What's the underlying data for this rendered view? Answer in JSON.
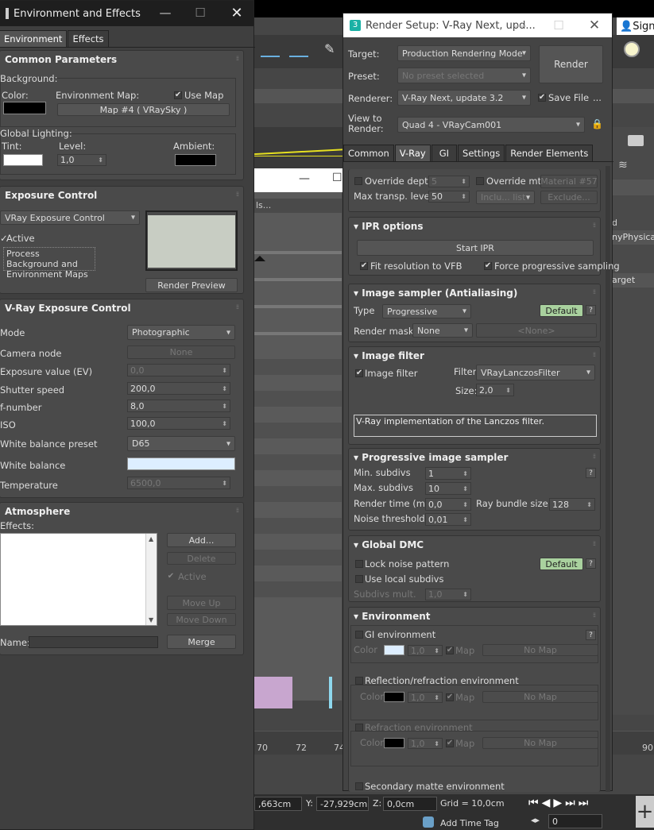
{
  "env": {
    "title": "Environment and Effects",
    "tabs": [
      "Environment",
      "Effects"
    ],
    "common": {
      "title": "Common Parameters",
      "background_label": "Background:",
      "color_label": "Color:",
      "env_map_label": "Environment Map:",
      "use_map_label": "Use Map",
      "map_button": "Map #4  ( VRaySky )",
      "global_lighting_label": "Global Lighting:",
      "tint_label": "Tint:",
      "level_label": "Level:",
      "level_value": "1,0",
      "ambient_label": "Ambient:"
    },
    "exposure": {
      "title": "Exposure Control",
      "dropdown": "VRay Exposure Control",
      "active_label": "Active",
      "process_bg_label": "Process Background and Environment Maps",
      "render_preview": "Render Preview"
    },
    "vray_exposure": {
      "title": "V-Ray Exposure Control",
      "rows": [
        {
          "label": "Mode",
          "value": "Photographic"
        },
        {
          "label": "Camera node",
          "value": "None"
        },
        {
          "label": "Exposure value (EV)",
          "value": "0,0"
        },
        {
          "label": "Shutter speed",
          "value": "200,0"
        },
        {
          "label": "f-number",
          "value": "8,0"
        },
        {
          "label": "ISO",
          "value": "100,0"
        },
        {
          "label": "White balance preset",
          "value": "D65"
        },
        {
          "label": "White balance",
          "value": ""
        },
        {
          "label": "Temperature",
          "value": "6500,0"
        }
      ]
    },
    "atmosphere": {
      "title": "Atmosphere",
      "effects_label": "Effects:",
      "add": "Add...",
      "delete": "Delete",
      "active": "Active",
      "move_up": "Move Up",
      "move_down": "Move Down",
      "name_label": "Name:",
      "merge": "Merge"
    }
  },
  "render": {
    "title": "Render Setup: V-Ray Next, upd...",
    "target_label": "Target:",
    "target_value": "Production Rendering Mode",
    "preset_label": "Preset:",
    "preset_value": "No preset selected",
    "renderer_label": "Renderer:",
    "renderer_value": "V-Ray Next, update 3.2",
    "save_file_label": "Save File",
    "ellipsis": "...",
    "view_label": "View to Render:",
    "view_value": "Quad 4 - VRayCam001",
    "render_button": "Render",
    "tabs": [
      "Common",
      "V-Ray",
      "GI",
      "Settings",
      "Render Elements"
    ],
    "global": {
      "override_depth": "Override depth",
      "override_depth_value": "5",
      "override_mtl": "Override mtl",
      "override_mtl_value": "Material #57",
      "max_transp": "Max transp. levels",
      "max_transp_value": "50",
      "include_list": "Inclu... list",
      "exclude": "Exclude..."
    },
    "ipr": {
      "title": "IPR options",
      "start": "Start IPR",
      "fit": "Fit resolution to VFB",
      "force": "Force progressive sampling"
    },
    "sampler": {
      "title": "Image sampler (Antialiasing)",
      "type_label": "Type",
      "type_value": "Progressive",
      "default": "Default",
      "mask_label": "Render mask",
      "mask_value": "None",
      "mask_none": "<None>"
    },
    "filter": {
      "title": "Image filter",
      "cb_label": "Image filter",
      "filter_label": "Filter",
      "filter_value": "VRayLanczosFilter",
      "size_label": "Size:",
      "size_value": "2,0",
      "description": "V-Ray implementation of the Lanczos filter."
    },
    "progressive": {
      "title": "Progressive image sampler",
      "min_label": "Min. subdivs",
      "min_value": "1",
      "max_label": "Max. subdivs",
      "max_value": "10",
      "time_label": "Render time (min)",
      "time_value": "0,0",
      "bundle_label": "Ray bundle size",
      "bundle_value": "128",
      "noise_label": "Noise threshold",
      "noise_value": "0,01"
    },
    "dmc": {
      "title": "Global DMC",
      "lock": "Lock noise pattern",
      "default": "Default",
      "local": "Use local subdivs",
      "mult_label": "Subdivs mult.",
      "mult_value": "1,0"
    },
    "environment": {
      "title": "Environment",
      "gi": "GI environment",
      "color_label": "Color",
      "value": "1,0",
      "map_label": "Map",
      "no_map": "No Map",
      "reflection": "Reflection/refraction environment",
      "refraction": "Refraction environment",
      "secondary": "Secondary matte environment"
    }
  },
  "bg": {
    "sign": "Sign",
    "ticks": [
      "70",
      "72",
      "74",
      "90"
    ],
    "x_value": ",663cm",
    "y_label": "Y:",
    "y_value": "-27,929cm",
    "z_label": "Z:",
    "z_value": "0,0cm",
    "grid": "Grid = 10,0cm",
    "add_time_tag": "Add Time Tag",
    "frame": "0",
    "phys": "nyPhysicalC",
    "target": "arget",
    "d": "d",
    "dots": "ls..."
  },
  "colors": {
    "env_bg_color": "#000000",
    "tint": "#ffffff",
    "ambient": "#000000",
    "preview": "#c8cdc3",
    "white_balance": "#ddeeff",
    "gi_color": "#ddeeff",
    "refl_color": "#000000",
    "default_green": "#a9d19e"
  }
}
